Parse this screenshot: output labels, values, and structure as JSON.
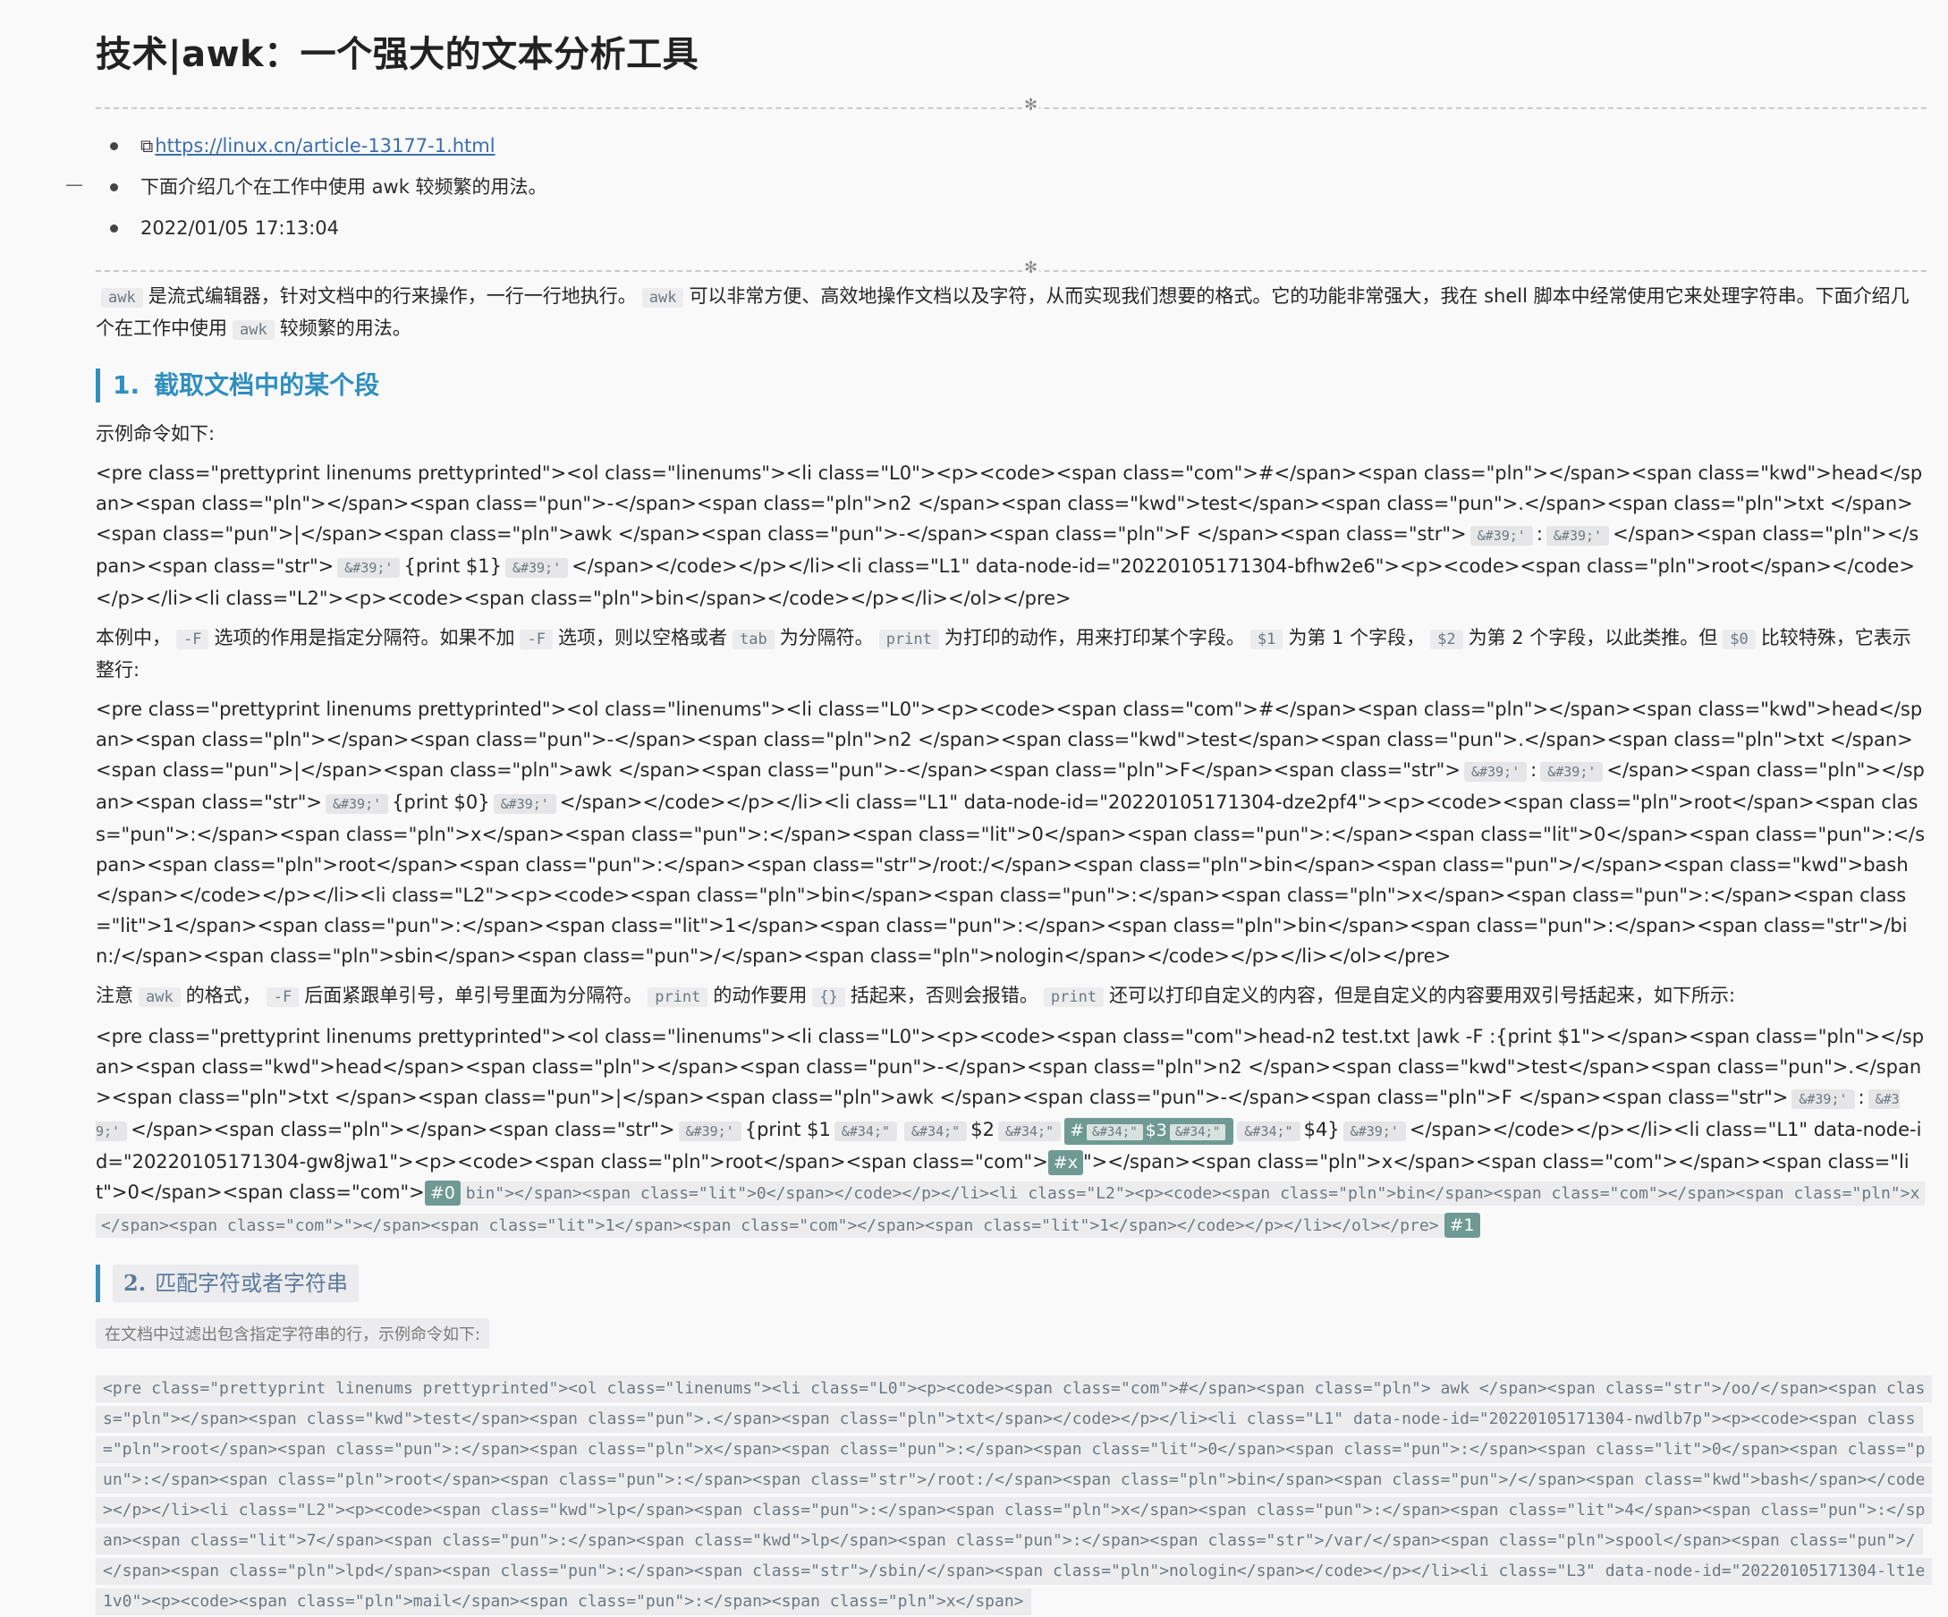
{
  "title": "技术|awk：一个强大的文本分析工具",
  "meta": {
    "link": "https://linux.cn/article-13177-1.html",
    "summary": "下面介绍几个在工作中使用 awk 较频繁的用法。",
    "date": "2022/01/05 17:13:04",
    "collapse_marker": "—",
    "star": "✻"
  },
  "intro": {
    "c_awk": "awk",
    "t1": "是流式编辑器，针对文档中的行来操作，一行一行地执行。",
    "t2": "可以非常方便、高效地操作文档以及字符，从而实现我们想要的格式。它的功能非常强大，我在 shell 脚本中经常使用它来处理字符串。下面介绍几个在工作中使用",
    "t3": "较频繁的用法。"
  },
  "section1": {
    "num": "1.",
    "title": "截取文档中的某个段",
    "example": "示例命令如下:",
    "code1": {
      "a": "<pre class=\"prettyprint linenums prettyprinted\"><ol class=\"linenums\"><li class=\"L0\"><p><code><span class=\"com\">#</span><span class=\"pln\"></span><span class=\"kwd\">head</span><span class=\"pln\"></span><span class=\"pun\">-</span><span class=\"pln\">n2 </span><span class=\"kwd\">test</span><span class=\"pun\">.</span><span class=\"pln\">txt </span><span class=\"pun\">|</span><span class=\"pln\">awk </span><span class=\"pun\">-</span><span class=\"pln\">F </span><span class=\"str\">",
      "t1": "&#39;'",
      "b": ":",
      "t2": "&#39;'",
      "c": "</span><span class=\"pln\"></span><span class=\"str\">",
      "t3": "&#39;'",
      "d": "{print $1}",
      "t4": "&#39;'",
      "e": "</span></code></p></li><li class=\"L1\" data-node-id=\"20220105171304-bfhw2e6\"><p><code><span class=\"pln\">root</span></code></p></li><li class=\"L2\"><p><code><span class=\"pln\">bin</span></code></p></li></ol></pre>"
    },
    "para2": {
      "a": "本例中，",
      "c1": "-F",
      "b": "选项的作用是指定分隔符。如果不加",
      "c2": "-F",
      "c": "选项，则以空格或者",
      "c3": "tab",
      "d": "为分隔符。",
      "c4": "print",
      "e": "为打印的动作，用来打印某个字段。",
      "c5": "$1",
      "f": "为第 1 个字段，",
      "c6": "$2",
      "g": "为第 2 个字段，以此类推。但",
      "c7": "$0",
      "h": "比较特殊，它表示整行:"
    },
    "code2": {
      "a": "<pre class=\"prettyprint linenums prettyprinted\"><ol class=\"linenums\"><li class=\"L0\"><p><code><span class=\"com\">#</span><span class=\"pln\"></span><span class=\"kwd\">head</span><span class=\"pln\"></span><span class=\"pun\">-</span><span class=\"pln\">n2 </span><span class=\"kwd\">test</span><span class=\"pun\">.</span><span class=\"pln\">txt </span><span class=\"pun\">|</span><span class=\"pln\">awk </span><span class=\"pun\">-</span><span class=\"pln\">F</span><span class=\"str\">",
      "t1": "&#39;'",
      "b": ":",
      "t2": "&#39;'",
      "c": "</span><span class=\"pln\"></span><span class=\"str\">",
      "t3": "&#39;'",
      "d": "{print $0}",
      "t4": "&#39;'",
      "e": "</span></code></p></li><li class=\"L1\" data-node-id=\"20220105171304-dze2pf4\"><p><code><span class=\"pln\">root</span><span class=\"pun\">:</span><span class=\"pln\">x</span><span class=\"pun\">:</span><span class=\"lit\">0</span><span class=\"pun\">:</span><span class=\"lit\">0</span><span class=\"pun\">:</span><span class=\"pln\">root</span><span class=\"pun\">:</span><span class=\"str\">/root:/</span><span class=\"pln\">bin</span><span class=\"pun\">/</span><span class=\"kwd\">bash</span></code></p></li><li class=\"L2\"><p><code><span class=\"pln\">bin</span><span class=\"pun\">:</span><span class=\"pln\">x</span><span class=\"pun\">:</span><span class=\"lit\">1</span><span class=\"pun\">:</span><span class=\"lit\">1</span><span class=\"pun\">:</span><span class=\"pln\">bin</span><span class=\"pun\">:</span><span class=\"str\">/bin:/</span><span class=\"pln\">sbin</span><span class=\"pun\">/</span><span class=\"pln\">nologin</span></code></p></li></ol></pre>"
    },
    "para3": {
      "a": "注意",
      "c1": "awk",
      "b": "的格式，",
      "c2": "-F",
      "c": "后面紧跟单引号，单引号里面为分隔符。",
      "c3": "print",
      "d": "的动作要用",
      "c4": "{}",
      "e": "括起来，否则会报错。",
      "c5": "print",
      "f": "还可以打印自定义的内容，但是自定义的内容要用双引号括起来，如下所示:"
    },
    "code3": {
      "a": "<pre class=\"prettyprint linenums prettyprinted\"><ol class=\"linenums\"><li class=\"L0\"><p><code><span class=\"com\">head-n2 test.txt |awk -F :{print $1\"></span><span class=\"pln\"></span><span class=\"kwd\">head</span><span class=\"pln\"></span><span class=\"pun\">-</span><span class=\"pln\">n2 </span><span class=\"kwd\">test</span><span class=\"pun\">.</span><span class=\"pln\">txt </span><span class=\"pun\">|</span><span class=\"pln\">awk </span><span class=\"pun\">-</span><span class=\"pln\">F </span><span class=\"str\">",
      "t1": "&#39;'",
      "b": ":",
      "t2": "&#39;'",
      "c": "</span><span class=\"pln\"></span><span class=\"str\">",
      "t3": "&#39;'",
      "d": "{print $1",
      "t4": "&#34;\"",
      "t5": "&#34;\"",
      "e": "$2",
      "t6": "&#34;\"",
      "hash_label": "#",
      "hash_inner1": "&#34;\"",
      "hash_val": "$3",
      "hash_inner2": "&#34;\"",
      "t7": "&#34;\"",
      "f": "$4}",
      "t8": "&#39;'",
      "g": "</span></code></p></li><li class=\"L1\" data-node-id=\"20220105171304-gw8jwa1\"><p><code><span class=\"pln\">root</span><span class=\"com\">",
      "tag_x": "#x",
      "h": "\"></span><span class=\"pln\">x</span><span class=\"com\"></span><span class=\"lit\">0</span><span class=\"com\">",
      "tag_0": "#0",
      "i": "bin\"></span><span class=\"lit\">0</span></code></p></li><li class=\"L2\"><p><code><span class=\"pln\">bin</span><span class=\"com\"></span><span class=\"pln\">x</span><span class=\"com\">\"></span><span class=\"lit\">1</span><span class=\"com\"></span><span class=\"lit\">1</span></code></p></li></ol></pre>",
      "tag_1": "#1"
    }
  },
  "section2": {
    "num": "2.",
    "title": "匹配字符或者字符串",
    "note": "在文档中过滤出包含指定字符串的行，示例命令如下:",
    "code": "<pre class=\"prettyprint linenums prettyprinted\"><ol class=\"linenums\"><li class=\"L0\"><p><code><span class=\"com\">#</span><span class=\"pln\"> awk </span><span class=\"str\">/oo/</span><span class=\"pln\"></span><span class=\"kwd\">test</span><span class=\"pun\">.</span><span class=\"pln\">txt</span></code></p></li><li class=\"L1\" data-node-id=\"20220105171304-nwdlb7p\"><p><code><span class=\"pln\">root</span><span class=\"pun\">:</span><span class=\"pln\">x</span><span class=\"pun\">:</span><span class=\"lit\">0</span><span class=\"pun\">:</span><span class=\"lit\">0</span><span class=\"pun\">:</span><span class=\"pln\">root</span><span class=\"pun\">:</span><span class=\"str\">/root:/</span><span class=\"pln\">bin</span><span class=\"pun\">/</span><span class=\"kwd\">bash</span></code></p></li><li class=\"L2\"><p><code><span class=\"kwd\">lp</span><span class=\"pun\">:</span><span class=\"pln\">x</span><span class=\"pun\">:</span><span class=\"lit\">4</span><span class=\"pun\">:</span><span class=\"lit\">7</span><span class=\"pun\">:</span><span class=\"kwd\">lp</span><span class=\"pun\">:</span><span class=\"str\">/var/</span><span class=\"pln\">spool</span><span class=\"pun\">/</span><span class=\"pln\">lpd</span><span class=\"pun\">:</span><span class=\"str\">/sbin/</span><span class=\"pln\">nologin</span></code></p></li><li class=\"L3\" data-node-id=\"20220105171304-lt1e1v0\"><p><code><span class=\"pln\">mail</span><span class=\"pun\">:</span><span class=\"pln\">x</span>"
  }
}
